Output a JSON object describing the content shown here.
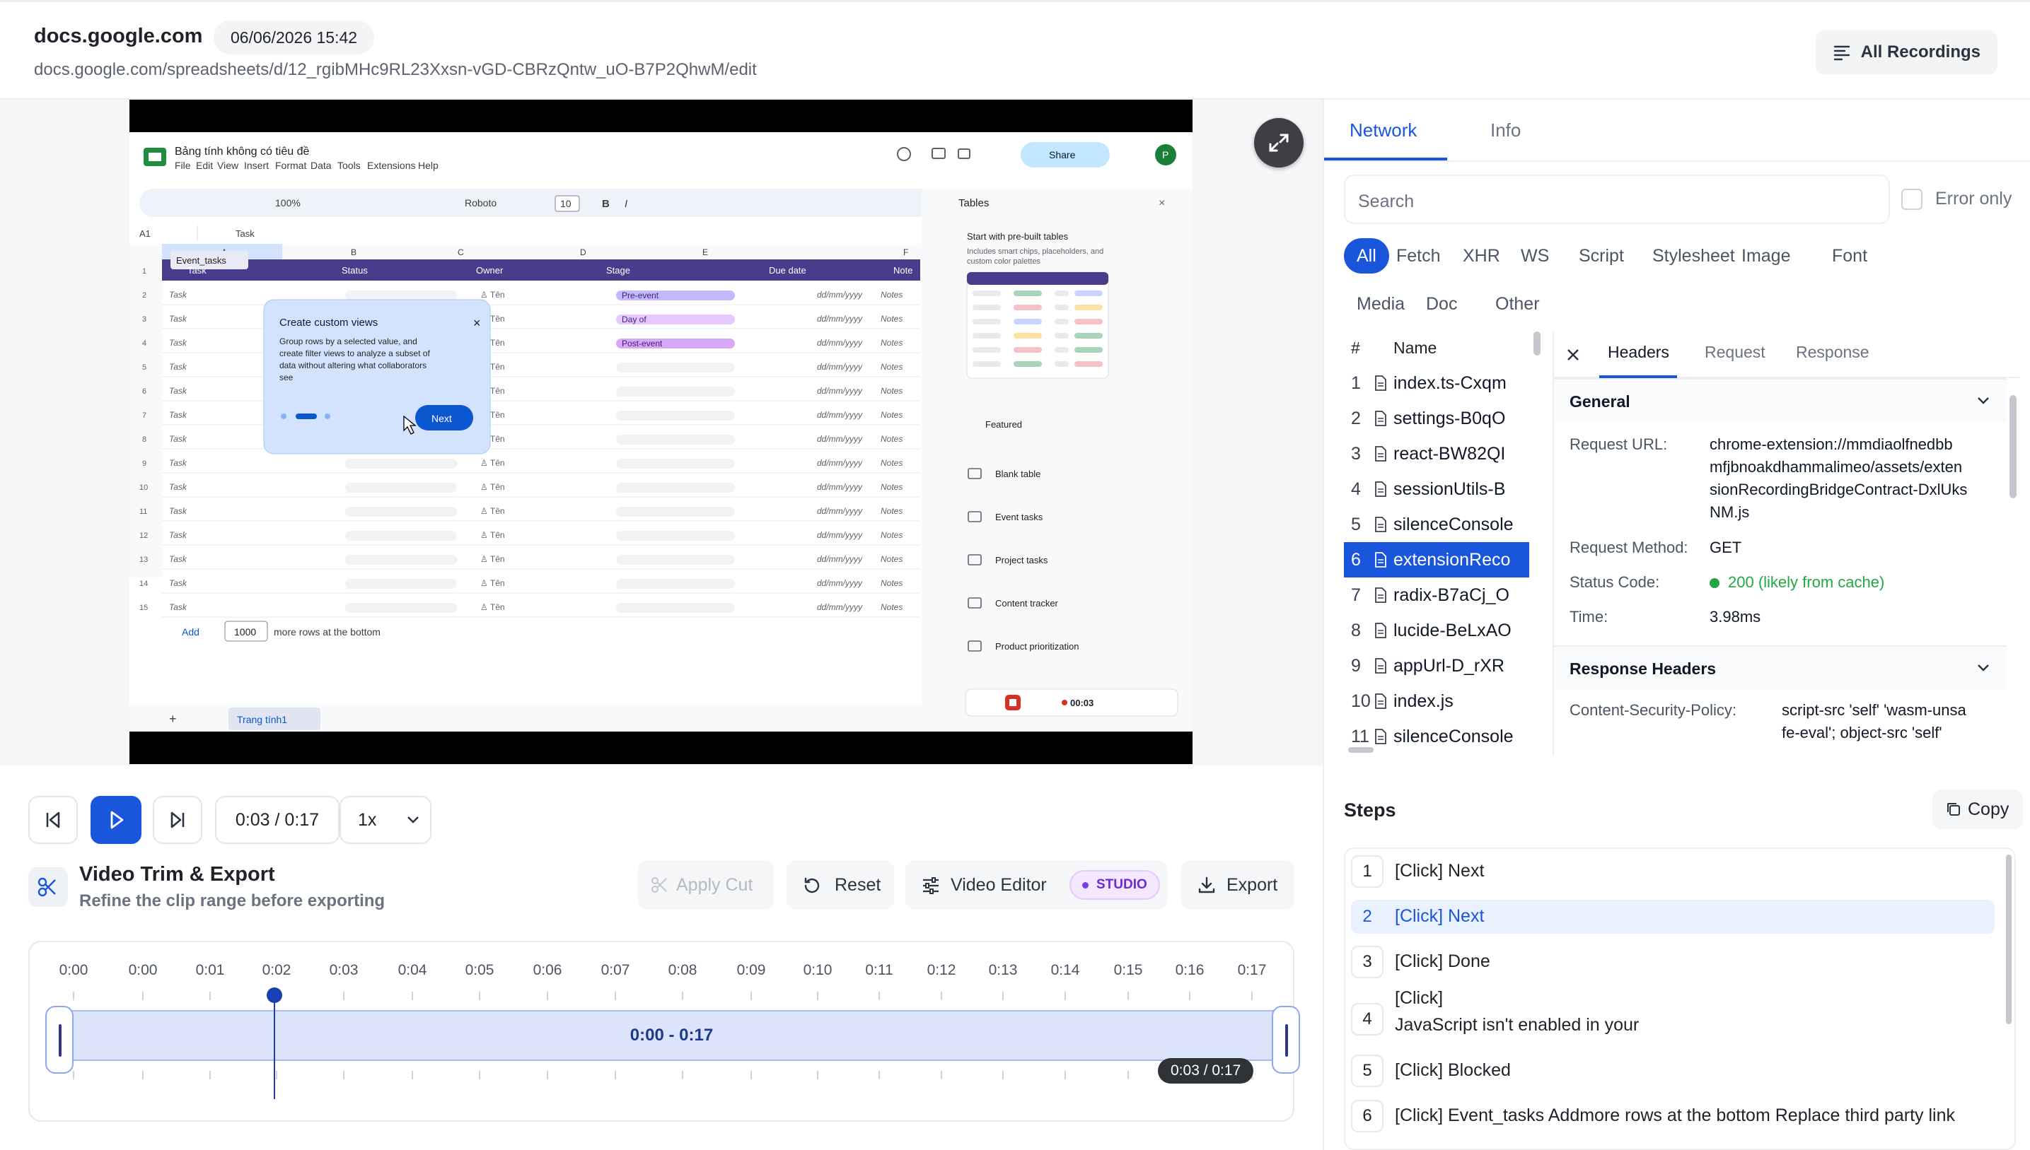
{
  "header": {
    "domain": "docs.google.com",
    "date": "06/06/2026 15:42",
    "url": "docs.google.com/spreadsheets/d/12_rgibMHc9RL23Xxsn-vGD-CBRzQntw_uO-B7P2QhwM/edit",
    "all_recordings": "All Recordings"
  },
  "sheet": {
    "title": "Bảng tính không có tiêu đề",
    "menus": [
      "File",
      "Edit",
      "View",
      "Insert",
      "Format",
      "Data",
      "Tools",
      "Extensions",
      "Help"
    ],
    "zoom": "100%",
    "font": "Roboto",
    "font_size": "10",
    "cell_ref": "A1",
    "formula": "Task",
    "share": "Share",
    "cols": [
      "A",
      "B",
      "C",
      "D",
      "E",
      "F"
    ],
    "table_name": "Event_tasks",
    "headers": [
      "Task",
      "Status",
      "Owner",
      "Stage",
      "Due date",
      "Note"
    ],
    "rows": [
      {
        "n": "2",
        "task": "Task",
        "owner": "Tên",
        "stage": "Pre-event",
        "due": "dd/mm/yyyy",
        "notes": "Notes"
      },
      {
        "n": "3",
        "task": "Task",
        "owner": "Tên",
        "stage": "Day of",
        "due": "dd/mm/yyyy",
        "notes": "Notes"
      },
      {
        "n": "4",
        "task": "Task",
        "owner": "Tên",
        "stage": "Post-event",
        "due": "dd/mm/yyyy",
        "notes": "Notes"
      },
      {
        "n": "5",
        "task": "Task",
        "owner": "Tên",
        "stage": "",
        "due": "dd/mm/yyyy",
        "notes": "Notes"
      },
      {
        "n": "6",
        "task": "Task",
        "owner": "Tên",
        "stage": "",
        "due": "dd/mm/yyyy",
        "notes": "Notes"
      },
      {
        "n": "7",
        "task": "Task",
        "owner": "Tên",
        "stage": "",
        "due": "dd/mm/yyyy",
        "notes": "Notes"
      },
      {
        "n": "8",
        "task": "Task",
        "owner": "Tên",
        "stage": "",
        "due": "dd/mm/yyyy",
        "notes": "Notes"
      },
      {
        "n": "9",
        "task": "Task",
        "owner": "Tên",
        "stage": "",
        "due": "dd/mm/yyyy",
        "notes": "Notes"
      },
      {
        "n": "10",
        "task": "Task",
        "owner": "Tên",
        "stage": "",
        "due": "dd/mm/yyyy",
        "notes": "Notes"
      },
      {
        "n": "11",
        "task": "Task",
        "owner": "Tên",
        "stage": "",
        "due": "dd/mm/yyyy",
        "notes": "Notes"
      },
      {
        "n": "12",
        "task": "Task",
        "owner": "Tên",
        "stage": "",
        "due": "dd/mm/yyyy",
        "notes": "Notes"
      },
      {
        "n": "13",
        "task": "Task",
        "owner": "Tên",
        "stage": "",
        "due": "dd/mm/yyyy",
        "notes": "Notes"
      },
      {
        "n": "14",
        "task": "Task",
        "owner": "Tên",
        "stage": "",
        "due": "dd/mm/yyyy",
        "notes": "Notes"
      },
      {
        "n": "15",
        "task": "Task",
        "owner": "Tên",
        "stage": "",
        "due": "dd/mm/yyyy",
        "notes": "Notes"
      }
    ],
    "popup_title": "Create custom views",
    "popup_body": "Group rows by a selected value, and create filter views to analyze a subset of data without altering what collaborators see",
    "popup_next": "Next",
    "add": "Add",
    "add_count": "1000",
    "add_suffix": "more rows at the bottom",
    "sheet_tab": "Trang tính1",
    "panel_title": "Tables",
    "panel_sub": "Start with pre-built tables",
    "panel_desc": "Includes smart chips, placeholders, and custom color palettes",
    "featured": "Featured",
    "templates": [
      "Blank table",
      "Event tasks",
      "Project tasks",
      "Content tracker",
      "Product prioritization"
    ],
    "rec_time": "00:03"
  },
  "player": {
    "time": "0:03 / 0:17",
    "speed": "1x",
    "trim_title": "Video Trim & Export",
    "trim_subtitle": "Refine the clip range before exporting",
    "apply_cut": "Apply Cut",
    "reset": "Reset",
    "video_editor": "Video Editor",
    "studio": "STUDIO",
    "export": "Export",
    "ticks": [
      "0:00",
      "0:00",
      "0:01",
      "0:02",
      "0:03",
      "0:04",
      "0:05",
      "0:06",
      "0:07",
      "0:08",
      "0:09",
      "0:10",
      "0:11",
      "0:12",
      "0:13",
      "0:14",
      "0:15",
      "0:16",
      "0:17"
    ],
    "range_label": "0:00 - 0:17",
    "tooltip": "0:03 / 0:17",
    "progress": 0.176
  },
  "panel": {
    "tabs": [
      "Network",
      "Info"
    ],
    "search_placeholder": "Search",
    "error_only": "Error only",
    "filters": [
      "All",
      "Fetch",
      "XHR",
      "WS",
      "Script",
      "Stylesheet",
      "Image",
      "Font",
      "Media",
      "Doc",
      "Other"
    ],
    "col_num": "#",
    "col_name": "Name",
    "requests": [
      {
        "n": "1",
        "name": "index.ts-Cxqm"
      },
      {
        "n": "2",
        "name": "settings-B0qO"
      },
      {
        "n": "3",
        "name": "react-BW82QI"
      },
      {
        "n": "4",
        "name": "sessionUtils-B"
      },
      {
        "n": "5",
        "name": "silenceConsole"
      },
      {
        "n": "6",
        "name": "extensionReco"
      },
      {
        "n": "7",
        "name": "radix-B7aCj_O"
      },
      {
        "n": "8",
        "name": "lucide-BeLxAO"
      },
      {
        "n": "9",
        "name": "appUrl-D_rXR"
      },
      {
        "n": "10",
        "name": "index.js"
      },
      {
        "n": "11",
        "name": "silenceConsole"
      }
    ],
    "detail_tabs": [
      "Headers",
      "Request",
      "Response"
    ],
    "general": "General",
    "req_url_k": "Request URL:",
    "req_url_v": [
      "chrome-extension://mmdiaolfnedbb",
      "mfjbnoakdhammalimeo/assets/exten",
      "sionRecordingBridgeContract-DxlUks",
      "NM.js"
    ],
    "method_k": "Request Method:",
    "method_v": "GET",
    "status_k": "Status Code:",
    "status_v": "200 (likely from cache)",
    "time_k": "Time:",
    "time_v": "3.98ms",
    "resp_headers": "Response Headers",
    "csp_k": "Content-Security-Policy:",
    "csp_v": [
      "script-src 'self' 'wasm-unsa",
      "fe-eval'; object-src 'self'"
    ],
    "steps_title": "Steps",
    "copy": "Copy",
    "steps": [
      {
        "n": "1",
        "text": "[Click] Next"
      },
      {
        "n": "2",
        "text": "[Click] Next"
      },
      {
        "n": "3",
        "text": "[Click] Done"
      },
      {
        "n": "4",
        "text": "[Click]",
        "text2": "JavaScript isn't enabled in your"
      },
      {
        "n": "5",
        "text": "[Click] Blocked"
      },
      {
        "n": "6",
        "text": "[Click] Event_tasks Addmore rows at the bottom Replace third party link"
      }
    ]
  },
  "colors": {
    "accent": "#1a56db",
    "status_ok": "#22a745",
    "studio": "#7c3aed",
    "sheet_header": "#4a3b8c"
  }
}
